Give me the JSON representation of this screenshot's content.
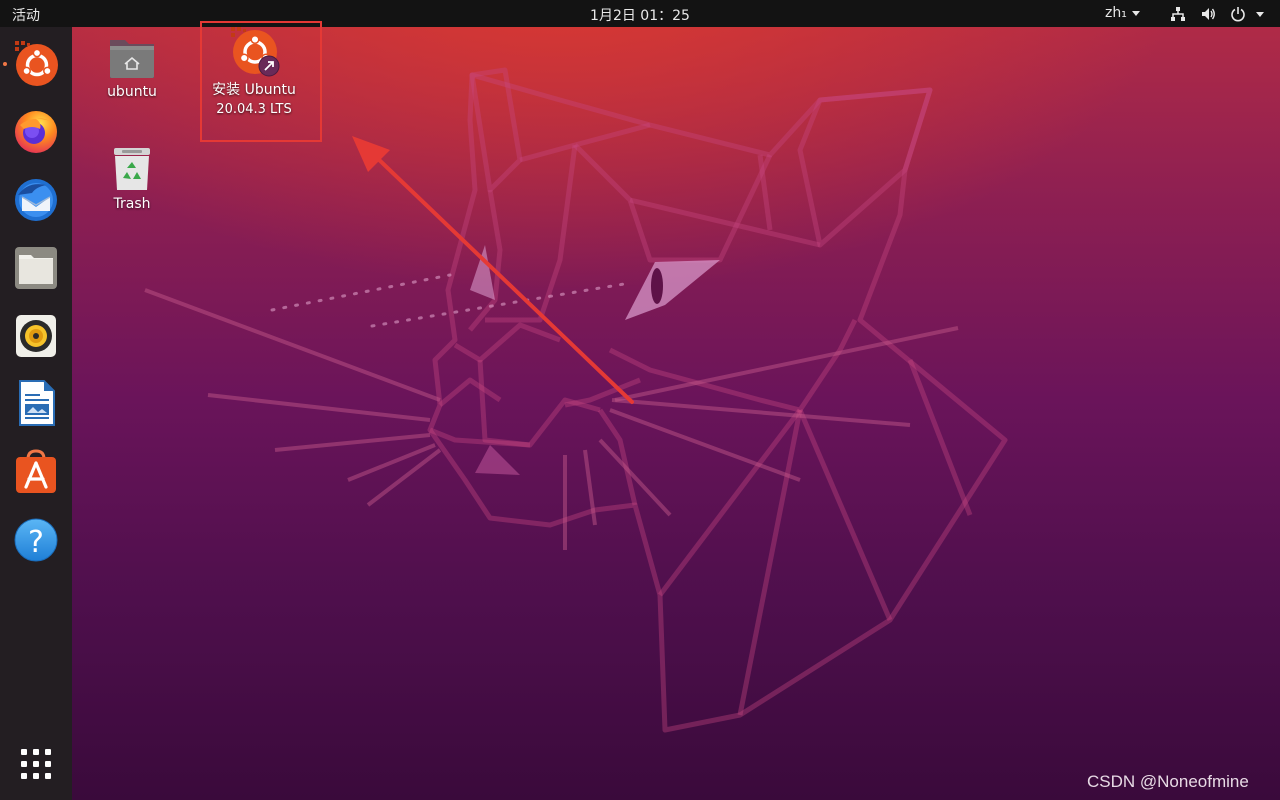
{
  "topbar": {
    "activities": "活动",
    "clock": "1月2日  01：25",
    "input_method": "zh₁",
    "tray_icons": [
      "network-icon",
      "volume-icon",
      "power-icon"
    ]
  },
  "dock": {
    "items": [
      {
        "name": "ubuntu-installer",
        "icon": "ubuntu-installer-icon"
      },
      {
        "name": "firefox",
        "icon": "firefox-icon"
      },
      {
        "name": "thunderbird",
        "icon": "thunderbird-icon"
      },
      {
        "name": "files",
        "icon": "files-icon"
      },
      {
        "name": "rhythmbox",
        "icon": "rhythmbox-icon"
      },
      {
        "name": "libreoffice-writer",
        "icon": "writer-icon"
      },
      {
        "name": "ubuntu-software",
        "icon": "software-icon"
      },
      {
        "name": "help",
        "icon": "help-icon",
        "glyph": "?"
      },
      {
        "name": "show-applications",
        "icon": "app-grid-icon"
      }
    ]
  },
  "desktop": {
    "home_label": "ubuntu",
    "trash_label": "Trash",
    "installer_label_line1": "安装 Ubuntu",
    "installer_label_line2": "20.04.3 LTS"
  },
  "colors": {
    "ubuntu_orange": "#e95420",
    "annotation_red": "#e53935",
    "topbar": "#131313",
    "dock": "#231e22"
  },
  "watermark": "CSDN @Noneofmine"
}
